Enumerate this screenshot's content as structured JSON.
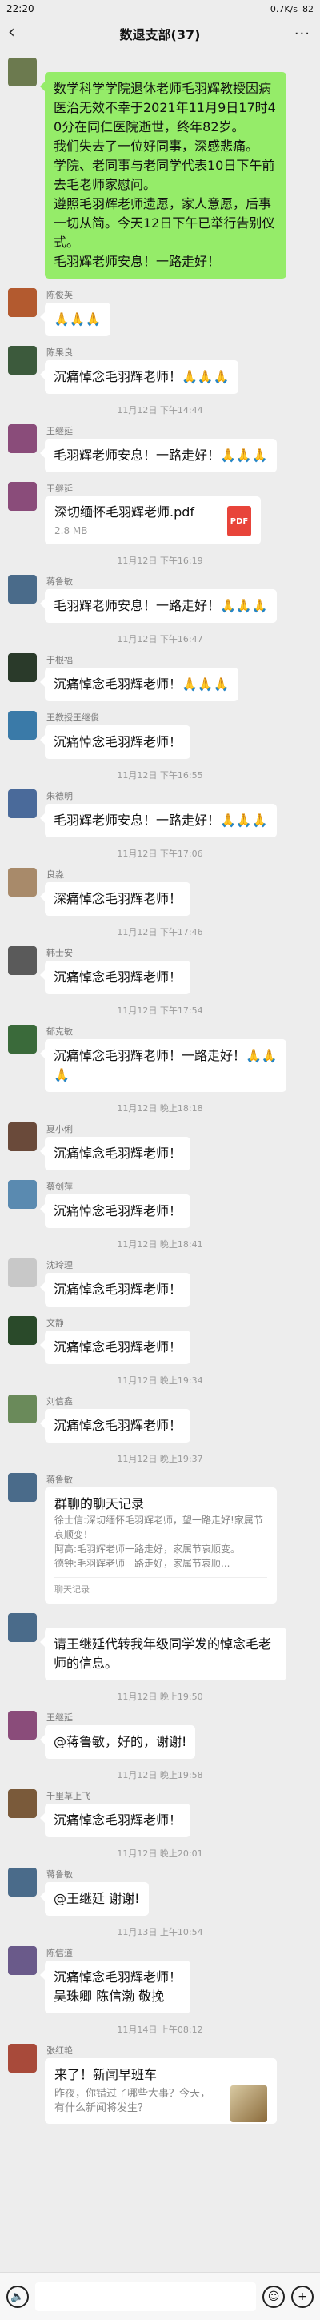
{
  "status": {
    "time": "22:20",
    "speed": "0.7K/s",
    "battery": "82"
  },
  "header": {
    "title": "数退支部(37)",
    "back": "‹",
    "more": "···"
  },
  "messages": [
    {
      "type": "text",
      "sender": "",
      "text": "数学科学学院退休老师毛羽辉教授因病医治无效不幸于2021年11月9日17时40分在同仁医院逝世，终年82岁。\n我们失去了一位好同事，深感悲痛。\n学院、老同事与老同学代表10日下午前去毛老师家慰问。\n遵照毛羽辉老师遗愿，家人意愿，后事一切从简。今天12日下午已举行告别仪式。\n毛羽辉老师安息！一路走好！",
      "green": true,
      "avatar": "#6c7a4f"
    },
    {
      "type": "text",
      "sender": "陈俊英",
      "text": "🙏🙏🙏",
      "avatar": "#b35a2f"
    },
    {
      "type": "text",
      "sender": "陈果良",
      "text": "沉痛悼念毛羽辉老师！🙏🙏🙏",
      "avatar": "#3c5a3c"
    },
    {
      "type": "time",
      "text": "11月12日 下午14:44"
    },
    {
      "type": "text",
      "sender": "王继延",
      "text": "毛羽辉老师安息！一路走好！🙏🙏🙏",
      "avatar": "#8a4c7a"
    },
    {
      "type": "file",
      "sender": "王继延",
      "name": "深切缅怀毛羽辉老师.pdf",
      "size": "2.8 MB",
      "avatar": "#8a4c7a"
    },
    {
      "type": "time",
      "text": "11月12日 下午16:19"
    },
    {
      "type": "text",
      "sender": "蒋鲁敏",
      "text": "毛羽辉老师安息！一路走好！🙏🙏🙏",
      "avatar": "#4a6b8a"
    },
    {
      "type": "time",
      "text": "11月12日 下午16:47"
    },
    {
      "type": "text",
      "sender": "于根福",
      "text": "沉痛悼念毛羽辉老师！🙏🙏🙏",
      "avatar": "#2a3a2a"
    },
    {
      "type": "text",
      "sender": "王教授王继俊",
      "text": "沉痛悼念毛羽辉老师！",
      "avatar": "#3a7aa8"
    },
    {
      "type": "time",
      "text": "11月12日 下午16:55"
    },
    {
      "type": "text",
      "sender": "朱德明",
      "text": "毛羽辉老师安息！一路走好！🙏🙏🙏",
      "avatar": "#4a6a9a"
    },
    {
      "type": "time",
      "text": "11月12日 下午17:06"
    },
    {
      "type": "text",
      "sender": "良淼",
      "text": "深痛悼念毛羽辉老师！",
      "avatar": "#a88a6a"
    },
    {
      "type": "time",
      "text": "11月12日 下午17:46"
    },
    {
      "type": "text",
      "sender": "韩士安",
      "text": "沉痛悼念毛羽辉老师！",
      "avatar": "#5a5a5a"
    },
    {
      "type": "time",
      "text": "11月12日 下午17:54"
    },
    {
      "type": "text",
      "sender": "郁克敏",
      "text": "沉痛悼念毛羽辉老师！一路走好！🙏🙏🙏",
      "avatar": "#3a6a3a"
    },
    {
      "type": "time",
      "text": "11月12日 晚上18:18"
    },
    {
      "type": "text",
      "sender": "夏小俐",
      "text": "沉痛悼念毛羽辉老师！",
      "avatar": "#6a4a3a"
    },
    {
      "type": "text",
      "sender": "蔡剑萍",
      "text": "沉痛悼念毛羽辉老师！",
      "avatar": "#5a8ab0"
    },
    {
      "type": "time",
      "text": "11月12日 晚上18:41"
    },
    {
      "type": "text",
      "sender": "沈玲理",
      "text": "沉痛悼念毛羽辉老师！",
      "avatar": "#c8c8c8"
    },
    {
      "type": "text",
      "sender": "文静",
      "text": "沉痛悼念毛羽辉老师！",
      "avatar": "#2a4a2a"
    },
    {
      "type": "time",
      "text": "11月12日 晚上19:34"
    },
    {
      "type": "text",
      "sender": "刘信鑫",
      "text": "沉痛悼念毛羽辉老师！",
      "avatar": "#6a8a5a"
    },
    {
      "type": "time",
      "text": "11月12日 晚上19:37"
    },
    {
      "type": "record",
      "sender": "蒋鲁敏",
      "title": "群聊的聊天记录",
      "lines": [
        "徐士信:深切缅怀毛羽辉老师，望一路走好!家属节哀顺变！",
        "阿高:毛羽辉老师一路走好，家属节哀顺变。",
        "德钟:毛羽辉老师一路走好，家属节哀顺..."
      ],
      "foot": "聊天记录",
      "avatar": "#4a6b8a"
    },
    {
      "type": "text",
      "sender": "",
      "text": "请王继延代转我年级同学发的悼念毛老师的信息。",
      "avatar": "#4a6b8a"
    },
    {
      "type": "time",
      "text": "11月12日 晚上19:50"
    },
    {
      "type": "text",
      "sender": "王继延",
      "text": "@蒋鲁敏，好的，谢谢!",
      "avatar": "#8a4c7a"
    },
    {
      "type": "time",
      "text": "11月12日 晚上19:58"
    },
    {
      "type": "text",
      "sender": "千里草上飞",
      "text": "沉痛悼念毛羽辉老师！",
      "avatar": "#7a5a3a"
    },
    {
      "type": "time",
      "text": "11月12日 晚上20:01"
    },
    {
      "type": "text",
      "sender": "蒋鲁敏",
      "text": "@王继延 谢谢!",
      "avatar": "#4a6b8a"
    },
    {
      "type": "time",
      "text": "11月13日 上午10:54"
    },
    {
      "type": "text",
      "sender": "陈信道",
      "text": "沉痛悼念毛羽辉老师！\n吴珠卿 陈信渤 敬挽",
      "avatar": "#6a5a8a"
    },
    {
      "type": "time",
      "text": "11月14日 上午08:12"
    },
    {
      "type": "news",
      "sender": "张红艳",
      "title": "来了！新闻早班车",
      "desc": "昨夜，你错过了哪些大事？今天，有什么新闻将发生？",
      "avatar": "#a84a3a"
    }
  ],
  "input": {
    "voice": "voice-icon",
    "emoji": "emoji-icon",
    "plus": "plus-icon"
  }
}
